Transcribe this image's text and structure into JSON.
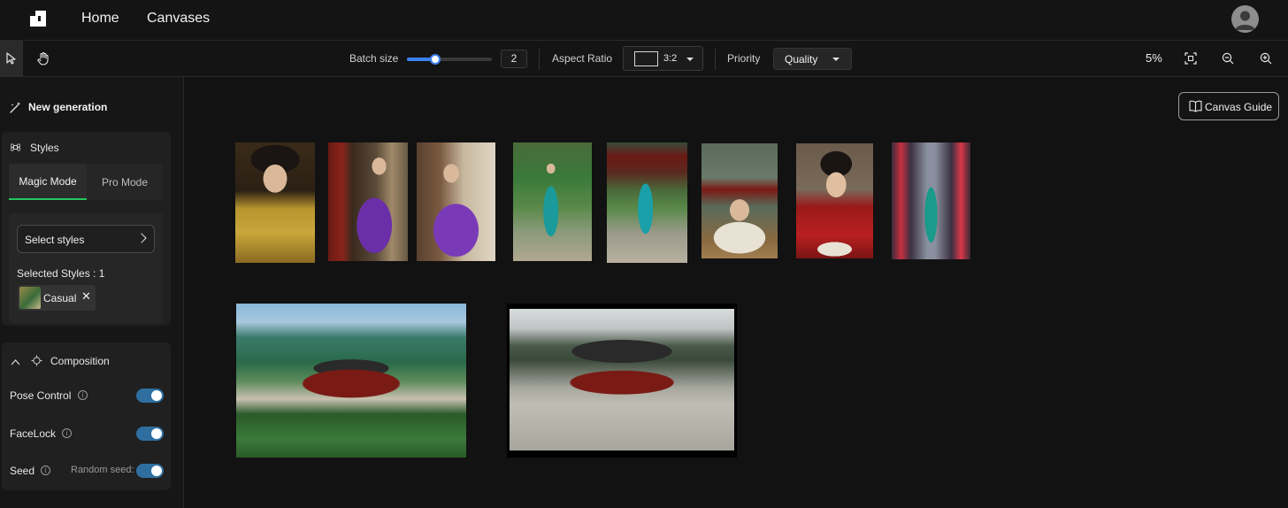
{
  "nav": {
    "links": [
      "Home",
      "Canvases"
    ]
  },
  "toolbar": {
    "batch_size_label": "Batch size",
    "batch_size_value": "2",
    "batch_slider_fraction": 0.33,
    "aspect_ratio_label": "Aspect Ratio",
    "aspect_ratio_value": "3:2",
    "priority_label": "Priority",
    "priority_value": "Quality",
    "zoom_level": "5%"
  },
  "sidebar": {
    "new_generation_label": "New generation",
    "styles": {
      "title": "Styles",
      "tabs": [
        "Magic Mode",
        "Pro Mode"
      ],
      "active_tab": "Magic Mode",
      "select_styles_label": "Select styles",
      "selected_count_label": "Selected Styles : 1",
      "selected_chip_label": "Casual",
      "chip_remove_glyph": "✕"
    },
    "composition": {
      "title": "Composition",
      "pose_control_label": "Pose Control",
      "facelock_label": "FaceLock",
      "seed_label": "Seed",
      "random_seed_label": "Random seed:"
    }
  },
  "canvas": {
    "guide_label": "Canvas Guide"
  },
  "colors": {
    "accent_blue": "#3b82f6",
    "toggle_blue": "#2f6fa0",
    "active_tab_green": "#22c55e",
    "background": "#141414"
  },
  "icons": {
    "logo": "brand-logo-icon",
    "select_tool": "cursor-arrow-icon",
    "pan_tool": "hand-icon",
    "fit_view": "fit-screen-icon",
    "zoom_out": "zoom-out-icon",
    "zoom_in": "zoom-in-icon",
    "new_gen": "magic-wand-icon",
    "styles": "command-icon",
    "composition": "crosshair-icon",
    "collapse": "chevron-up-icon",
    "guide": "book-icon"
  }
}
